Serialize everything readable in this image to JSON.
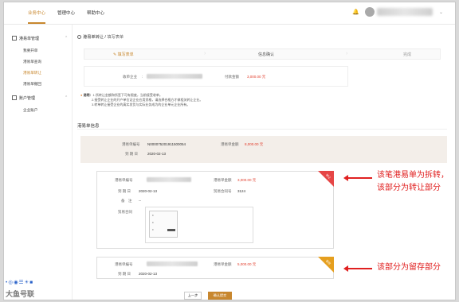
{
  "topnav": {
    "tabs": [
      "业务中心",
      "管理中心",
      "帮助中心"
    ],
    "active_index": 0
  },
  "sidebar": {
    "group1": "港易单管理",
    "items": [
      "我要开单",
      "港易单查询",
      "港易单转让",
      "港易单撤回"
    ],
    "active_item": 2,
    "group2": "账户管理",
    "group2_items": [
      "企业账户"
    ],
    "tray_text": "大鱼号联"
  },
  "breadcrumb": {
    "section": "港易单转让",
    "separator": "/",
    "current": "填写表单"
  },
  "steps": [
    "填写表单",
    "信息确认",
    "完成"
  ],
  "topbox": {
    "receiver_label": "收单企业",
    "amount_label": "付款金额",
    "amount_value": "3,000.00 元"
  },
  "notes": {
    "title": "说明：",
    "lines": [
      "1.所转让金额和所签下可有限度，当前接受收单。",
      "2.接受转让企业的开户单位证企业应用资格，请选择合格方才做相关转让企业。",
      "3.转单转让接受企业的真实发货与实际业务成为的企业单元企业所有。"
    ]
  },
  "section_title": "港易单信息",
  "original": {
    "number_label": "港易单编号",
    "number_value": "N000075201911500054",
    "amount_label": "港易单金额",
    "amount_value": "8,000.00 元",
    "date_label": "到 期 日",
    "date_value": "2020-02-13"
  },
  "split1": {
    "number_label": "港易单编号",
    "amount_label": "港易单金额",
    "amount_value": "3,000.00 元",
    "date_label": "到 期 日",
    "date_value": "2020-02-13",
    "contract_no_label": "贸易合同号",
    "contract_no_value": "3124",
    "remark_label": "备　注",
    "remark_value": "--",
    "contract_label": "贸易合同",
    "ribbon": "转让"
  },
  "split2": {
    "number_label": "港易单编号",
    "amount_label": "港易单金额",
    "amount_value": "5,000.00 元",
    "date_label": "到 期 日",
    "date_value": "2020-02-13",
    "ribbon": "留存"
  },
  "buttons": {
    "prev": "上一步",
    "submit": "确认提交"
  },
  "annotations": {
    "transfer_1": "该笔港易单为拆转，",
    "transfer_2": "该部分为转让部分",
    "retain": "该部分为留存部分"
  },
  "colors": {
    "accent": "#c8872e",
    "red": "#e2402f",
    "annotation": "#e02020",
    "ribbon_red": "#e64646",
    "ribbon_orange": "#e59f1f"
  }
}
